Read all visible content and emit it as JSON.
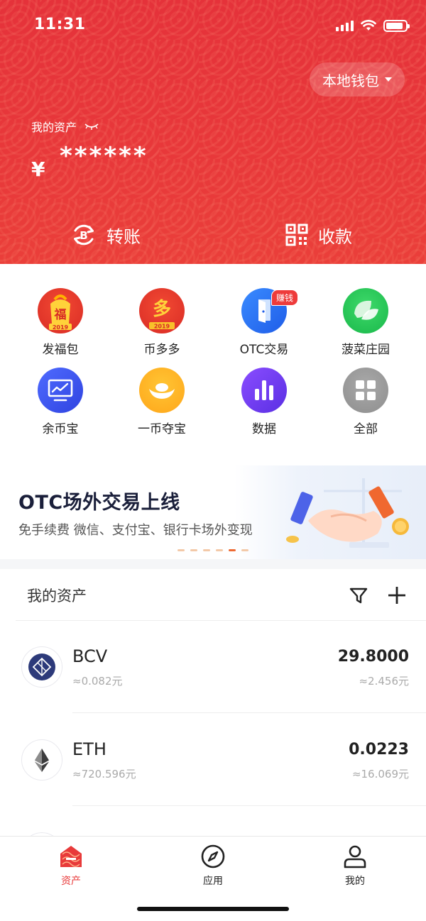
{
  "status_bar": {
    "time": "11:31"
  },
  "header": {
    "wallet_switch_label": "本地钱包",
    "assets_label": "我的资产",
    "currency_symbol": "¥",
    "masked_amount": "******",
    "actions": [
      {
        "label": "转账",
        "icon": "transfer-bitcoin-icon"
      },
      {
        "label": "收款",
        "icon": "qr-code-icon"
      }
    ]
  },
  "quick_grid": {
    "items": [
      {
        "label": "发福包",
        "icon": "fortune-bag-icon",
        "icon_text": "福",
        "year": "2019"
      },
      {
        "label": "币多多",
        "icon": "coin-more-icon",
        "icon_text": "多",
        "year": "2019"
      },
      {
        "label": "OTC交易",
        "icon": "otc-door-icon",
        "badge": "赚钱"
      },
      {
        "label": "菠菜庄园",
        "icon": "spinach-leaf-icon"
      },
      {
        "label": "余币宝",
        "icon": "monitor-chart-icon"
      },
      {
        "label": "一币夺宝",
        "icon": "gold-ingot-icon"
      },
      {
        "label": "数据",
        "icon": "bar-chart-icon"
      },
      {
        "label": "全部",
        "icon": "grid-all-icon"
      }
    ]
  },
  "banner": {
    "title": "OTC场外交易上线",
    "subtitle": "免手续费 微信、支付宝、银行卡场外变现",
    "active_dot": 4,
    "dot_count": 6
  },
  "assets_section": {
    "title": "我的资产",
    "rows": [
      {
        "name": "BCV",
        "price": "≈0.082元",
        "quantity": "29.8000",
        "value": "≈2.456元",
        "logo": "bcv-logo-icon"
      },
      {
        "name": "ETH",
        "price": "≈720.596元",
        "quantity": "0.0223",
        "value": "≈16.069元",
        "logo": "eth-logo-icon"
      }
    ]
  },
  "tabbar": {
    "tabs": [
      {
        "label": "资产",
        "icon": "asset-home-icon",
        "active": true
      },
      {
        "label": "应用",
        "icon": "compass-icon",
        "active": false
      },
      {
        "label": "我的",
        "icon": "user-icon",
        "active": false
      }
    ]
  },
  "colors": {
    "brand_red": "#e5323a",
    "active_tab": "#e83a3a"
  }
}
